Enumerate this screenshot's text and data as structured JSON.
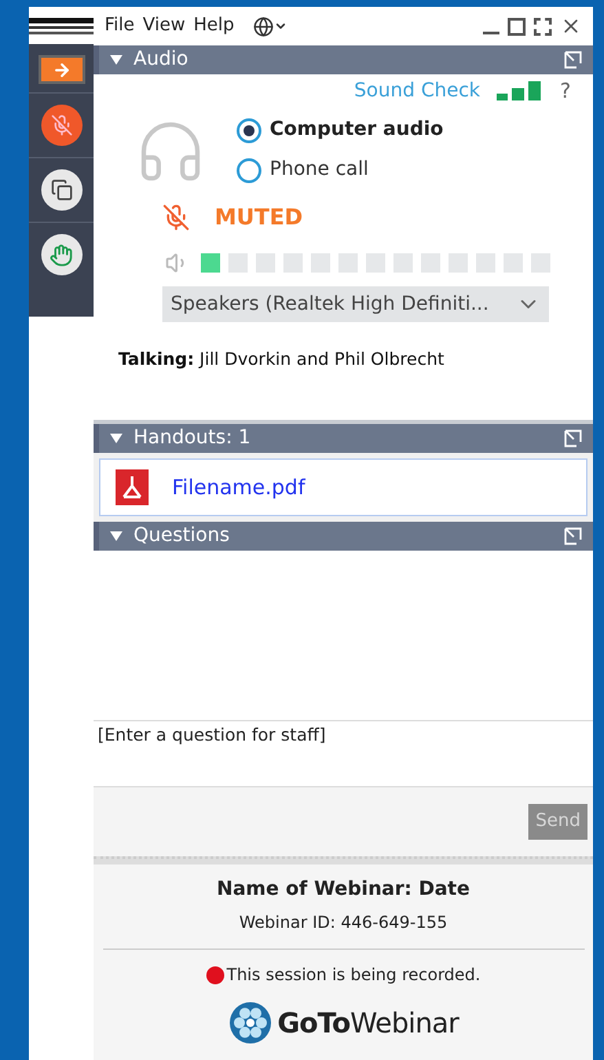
{
  "menu": [
    "File",
    "View",
    "Help"
  ],
  "audio": {
    "title": "Audio",
    "expanded": true,
    "sound_check": "Sound Check",
    "help": "?",
    "options": [
      {
        "label": "Computer audio",
        "selected": true
      },
      {
        "label": "Phone call",
        "selected": false
      }
    ],
    "muted": true,
    "status": "MUTED",
    "level": 0.077,
    "speaker": "Speakers (Realtek High Definiti...",
    "talking": "**Talking:** Jill Dvorkin and Phil Olbrecht"
  },
  "handouts": {
    "title": "Handouts: 1",
    "expanded": true,
    "files": [
      "Filename.pdf"
    ]
  },
  "questions": {
    "title": "Questions",
    "expanded": true,
    "placeholder": "[Enter a question for staff]",
    "send": {
      "label": "Send",
      "disabled": true
    }
  },
  "footer": {
    "title": "Name of Webinar: Date",
    "webinar_id": "Webinar ID: 446-649-155",
    "recording": "This session is being recorded.",
    "logo": "**GoTo**Webinar"
  }
}
